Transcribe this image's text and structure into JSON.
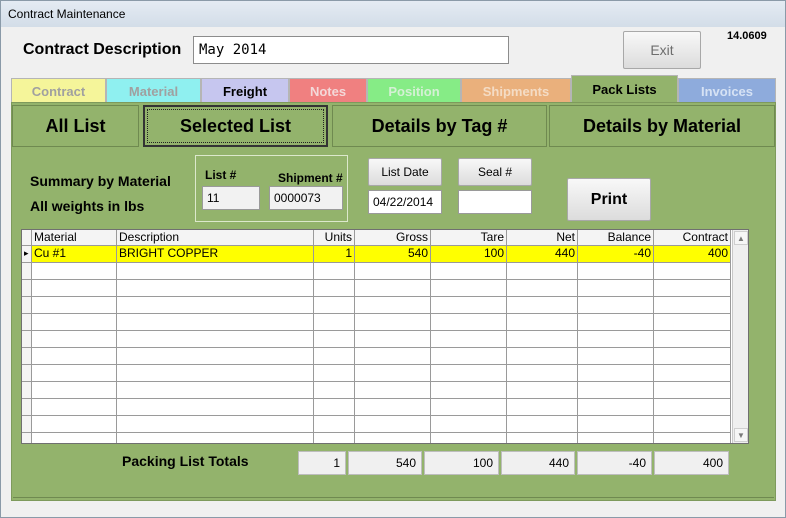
{
  "window": {
    "title": "Contract Maintenance",
    "version": "14.0609"
  },
  "header": {
    "contract_description_label": "Contract Description",
    "contract_description_value": "May 2014",
    "exit_label": "Exit"
  },
  "tabs": [
    {
      "label": "Contract",
      "bg": "#f5f59a",
      "fg": "#a0a0a0"
    },
    {
      "label": "Material",
      "bg": "#8ff0f0",
      "fg": "#a0a0a0"
    },
    {
      "label": "Freight",
      "bg": "#c6c6ef",
      "fg": "#000000"
    },
    {
      "label": "Notes",
      "bg": "#f08080",
      "fg": "#f3d8d8"
    },
    {
      "label": "Position",
      "bg": "#86ec86",
      "fg": "#d5f0d5"
    },
    {
      "label": "Shipments",
      "bg": "#eab07c",
      "fg": "#f4dcc5"
    },
    {
      "label": "Pack Lists",
      "bg": "#93b36c",
      "fg": "#000000"
    },
    {
      "label": "Invoices",
      "bg": "#8eabdc",
      "fg": "#d6e2f4"
    }
  ],
  "subtabs": [
    "All List",
    "Selected List",
    "Details by Tag #",
    "Details by Material"
  ],
  "summary": {
    "line1": "Summary by Material",
    "line2": "All weights in lbs",
    "list_label": "List #",
    "list_value": "11",
    "shipment_label": "Shipment #",
    "shipment_value": "0000073",
    "list_date_label": "List Date",
    "list_date_value": "04/22/2014",
    "seal_label": "Seal #",
    "seal_value": "",
    "print_label": "Print"
  },
  "grid": {
    "columns": [
      "Material",
      "Description",
      "Units",
      "Gross",
      "Tare",
      "Net",
      "Balance",
      "Contract"
    ],
    "rows": [
      [
        "Cu #1",
        "BRIGHT COPPER",
        "1",
        "540",
        "100",
        "440",
        "-40",
        "400"
      ]
    ],
    "highlight_color": "#ffff00"
  },
  "totals": {
    "label": "Packing List Totals",
    "values": [
      "1",
      "540",
      "100",
      "440",
      "-40",
      "400"
    ]
  }
}
